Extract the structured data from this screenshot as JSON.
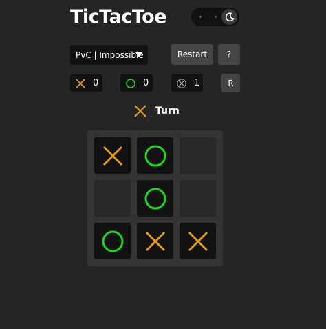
{
  "app": {
    "title": "TicTacToe"
  },
  "mode_select": {
    "value": "PvC | Impossible"
  },
  "buttons": {
    "restart": "Restart",
    "help": "?",
    "reset_scores": "R"
  },
  "scores": {
    "x": "0",
    "o": "0",
    "draw": "1"
  },
  "turn": {
    "player": "X",
    "label": "Turn"
  },
  "board": [
    "X",
    "O",
    "",
    "",
    "O",
    "",
    "O",
    "X",
    "X"
  ],
  "colors": {
    "x": "#e69b18",
    "o": "#1fd51f",
    "background": "#252525"
  }
}
